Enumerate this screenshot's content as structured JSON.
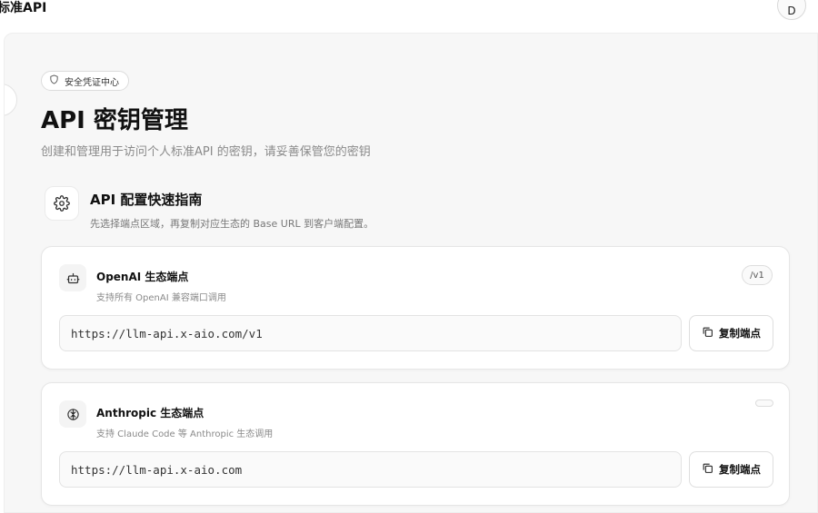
{
  "header": {
    "brand": "标准API",
    "avatar_initial": "D"
  },
  "page": {
    "badge": "安全凭证中心",
    "title": "API 密钥管理",
    "subtitle": "创建和管理用于访问个人标准API 的密钥，请妥善保管您的密钥"
  },
  "guide": {
    "title": "API 配置快速指南",
    "description": "先选择端点区域，再复制对应生态的 Base URL 到客户端配置。"
  },
  "endpoints": [
    {
      "title": "OpenAI 生态端点",
      "description": "支持所有 OpenAI 兼容端口调用",
      "path": "/v1",
      "url": "https://llm-api.x-aio.com/v1",
      "copy_label": "复制端点",
      "icon": "bot-icon"
    },
    {
      "title": "Anthropic 生态端点",
      "description": "支持 Claude Code 等 Anthropic 生态调用",
      "path": "",
      "url": "https://llm-api.x-aio.com",
      "copy_label": "复制端点",
      "icon": "brain-icon"
    }
  ],
  "icons": {
    "badge": "shield-icon",
    "guide": "gear-icon",
    "copy": "copy-icon"
  }
}
